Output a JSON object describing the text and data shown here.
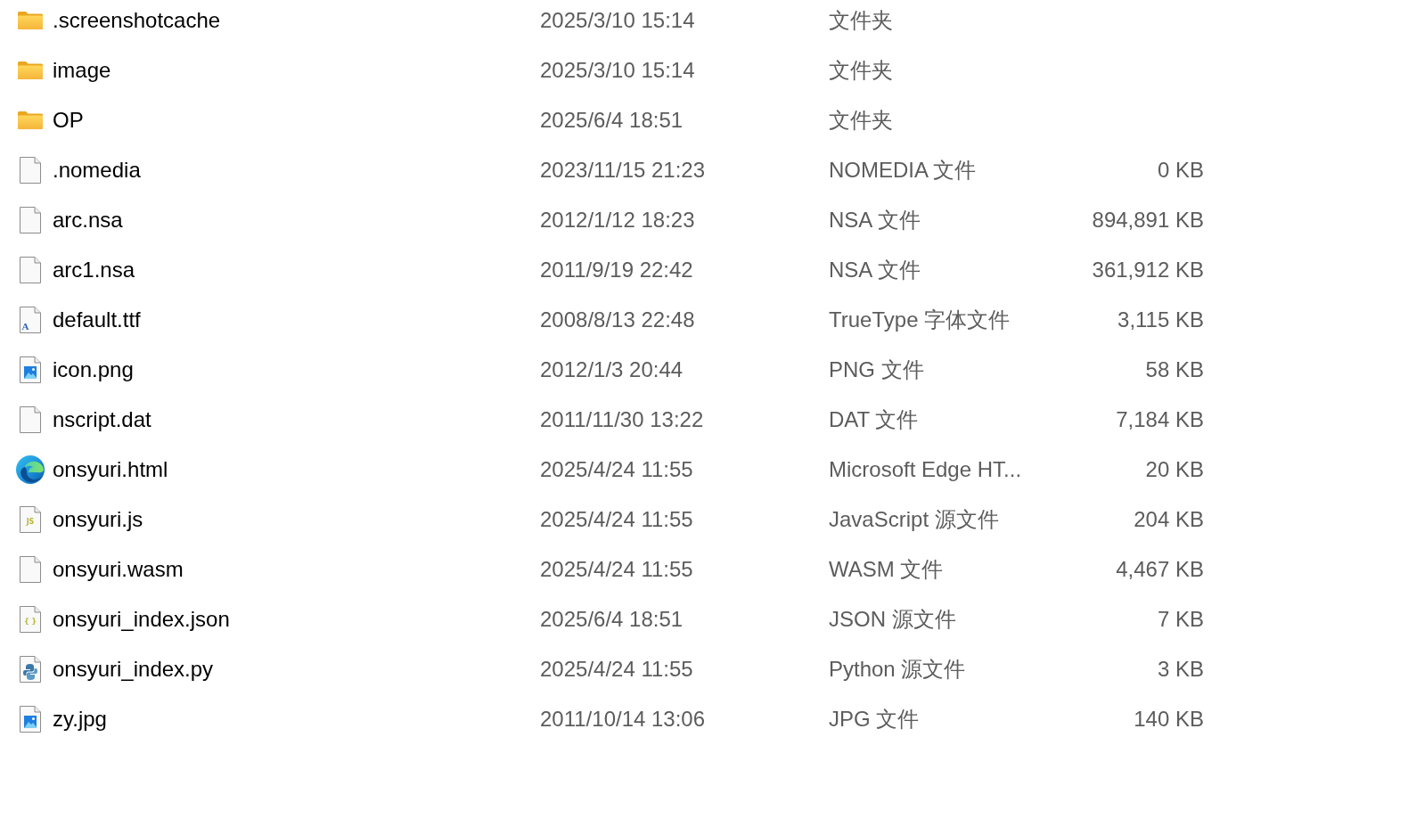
{
  "files": [
    {
      "kind": "folder",
      "name": ".screenshotcache",
      "modified": "2025/3/10 15:14",
      "type": "文件夹"
    },
    {
      "kind": "folder",
      "name": "image",
      "modified": "2025/3/10 15:14",
      "type": "文件夹"
    },
    {
      "kind": "folder",
      "name": "OP",
      "modified": "2025/6/4 18:51",
      "type": "文件夹"
    },
    {
      "kind": "file",
      "name": ".nomedia",
      "modified": "2023/11/15 21:23",
      "type": "NOMEDIA 文件",
      "size": "0 KB"
    },
    {
      "kind": "file",
      "name": "arc.nsa",
      "modified": "2012/1/12 18:23",
      "type": "NSA 文件",
      "size": "894,891 KB"
    },
    {
      "kind": "file",
      "name": "arc1.nsa",
      "modified": "2011/9/19 22:42",
      "type": "NSA 文件",
      "size": "361,912 KB"
    },
    {
      "kind": "font",
      "name": "default.ttf",
      "modified": "2008/8/13 22:48",
      "type": "TrueType 字体文件",
      "size": "3,115 KB",
      "icon_text": "A"
    },
    {
      "kind": "image",
      "name": "icon.png",
      "modified": "2012/1/3 20:44",
      "type": "PNG 文件",
      "size": "58 KB"
    },
    {
      "kind": "file",
      "name": "nscript.dat",
      "modified": "2011/11/30 13:22",
      "type": "DAT 文件",
      "size": "7,184 KB"
    },
    {
      "kind": "browser",
      "name": "onsyuri.html",
      "modified": "2025/4/24 11:55",
      "type": "Microsoft Edge HT...",
      "size": "20 KB"
    },
    {
      "kind": "code",
      "name": "onsyuri.js",
      "modified": "2025/4/24 11:55",
      "type": "JavaScript 源文件",
      "size": "204 KB",
      "icon_text": "JS"
    },
    {
      "kind": "file",
      "name": "onsyuri.wasm",
      "modified": "2025/4/24 11:55",
      "type": "WASM 文件",
      "size": "4,467 KB"
    },
    {
      "kind": "code",
      "name": "onsyuri_index.json",
      "modified": "2025/6/4 18:51",
      "type": "JSON 源文件",
      "size": "7 KB",
      "icon_text": "{ }"
    },
    {
      "kind": "python",
      "name": "onsyuri_index.py",
      "modified": "2025/4/24 11:55",
      "type": "Python 源文件",
      "size": "3 KB"
    },
    {
      "kind": "image",
      "name": "zy.jpg",
      "modified": "2011/10/14 13:06",
      "type": "JPG 文件",
      "size": "140 KB"
    }
  ]
}
